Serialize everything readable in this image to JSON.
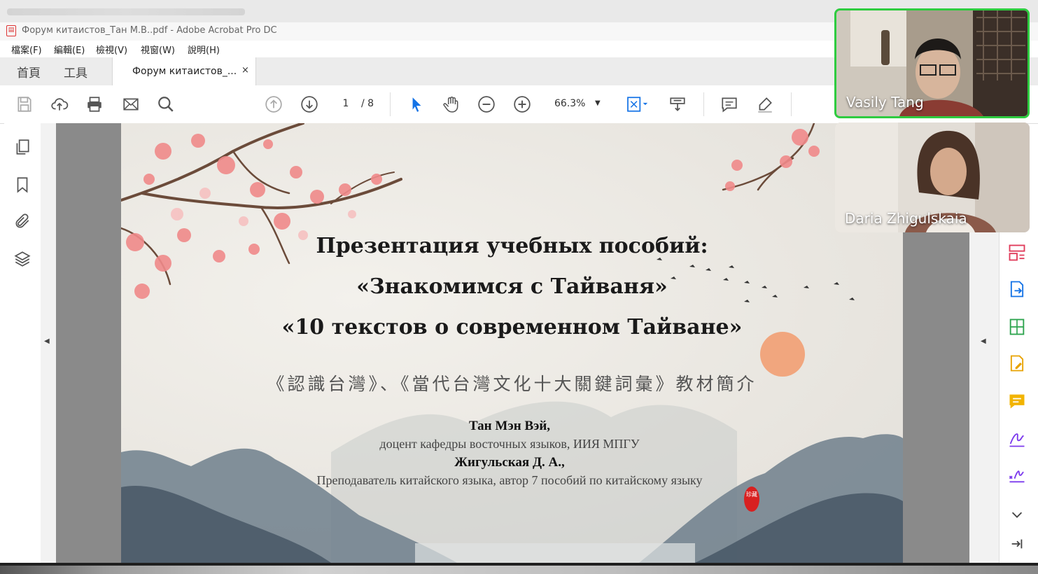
{
  "window": {
    "title": "Форум китаистов_Тан М.В..pdf - Adobe Acrobat Pro DC"
  },
  "menu": [
    "檔案(F)",
    "編輯(E)",
    "檢視(V)",
    "視窗(W)",
    "說明(H)"
  ],
  "tabs": {
    "home": "首頁",
    "tools": "工具",
    "document": "Форум китаистов_...",
    "close": "×"
  },
  "toolbar": {
    "page_current": "1",
    "page_total": "/ 8",
    "zoom": "66.3%"
  },
  "slide": {
    "title_line1": "Презентация учебных пособий:",
    "title_line2": "«Знакомимся с Тайваня»",
    "title_line3": "«10 текстов о современном Тайване»",
    "subtitle_zh": "《認識台灣》、《當代台灣文化十大關鍵詞彙》教材簡介",
    "author1_name": "Тан Мэн Вэй,",
    "author1_role": "доцент кафедры восточных языков, ИИЯ МПГУ",
    "author2_name": "Жигульская Д. А.,",
    "author2_role": "Преподаватель китайского языка, автор 7 пособий по китайскому языку",
    "seal_text": "珍藏"
  },
  "video": {
    "participant1": "Vasily Tang",
    "participant2": "Daria Zhigulskaia"
  },
  "colors": {
    "active_speaker_border": "#2ecc40",
    "acrobat_blue": "#1473e6",
    "pdf_red": "#dd3333"
  }
}
